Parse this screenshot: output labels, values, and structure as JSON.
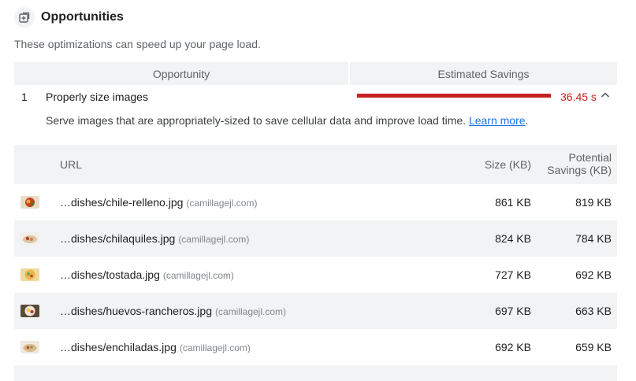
{
  "header": {
    "title": "Opportunities",
    "icon": "opportunity-icon"
  },
  "subtitle": "These optimizations can speed up your page load.",
  "table_headers": {
    "opportunity": "Opportunity",
    "savings": "Estimated Savings"
  },
  "opportunity": {
    "number": "1",
    "title": "Properly size images",
    "savings": "36.45 s",
    "savings_fraction": 1.0,
    "description": "Serve images that are appropriately-sized to save cellular data and improve load time.",
    "learn_more": "Learn more",
    "learn_more_suffix": "."
  },
  "details": {
    "headers": {
      "url": "URL",
      "size": "Size (KB)",
      "potential_line1": "Potential",
      "potential_line2": "Savings (KB)"
    },
    "rows": [
      {
        "path": "…dishes/chile-relleno.jpg",
        "origin": "(camillagejl.com)",
        "size": "861 KB",
        "savings": "819 KB"
      },
      {
        "path": "…dishes/chilaquiles.jpg",
        "origin": "(camillagejl.com)",
        "size": "824 KB",
        "savings": "784 KB"
      },
      {
        "path": "…dishes/tostada.jpg",
        "origin": "(camillagejl.com)",
        "size": "727 KB",
        "savings": "692 KB"
      },
      {
        "path": "…dishes/huevos-rancheros.jpg",
        "origin": "(camillagejl.com)",
        "size": "697 KB",
        "savings": "663 KB"
      },
      {
        "path": "…dishes/enchiladas.jpg",
        "origin": "(camillagejl.com)",
        "size": "692 KB",
        "savings": "659 KB"
      }
    ]
  },
  "colors": {
    "fail": "#c5221f",
    "link": "#1a73e8",
    "stripe": "#f1f3f4"
  }
}
